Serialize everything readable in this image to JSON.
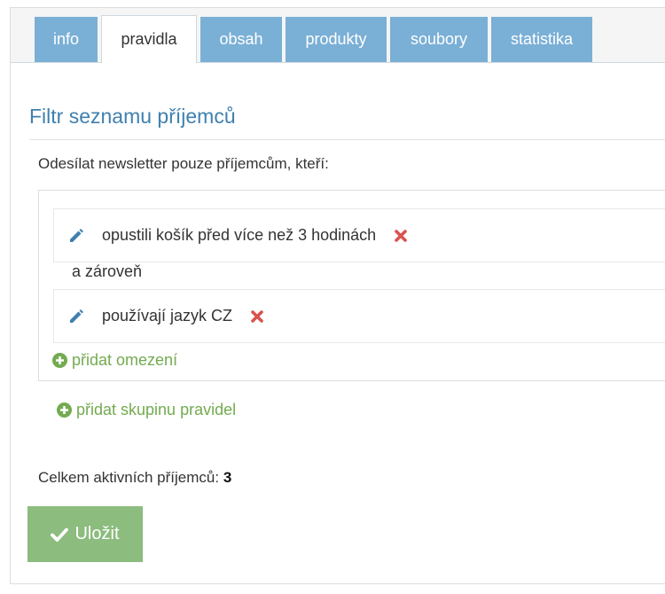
{
  "tabs": [
    {
      "label": "info",
      "active": false
    },
    {
      "label": "pravidla",
      "active": true
    },
    {
      "label": "obsah",
      "active": false
    },
    {
      "label": "produkty",
      "active": false
    },
    {
      "label": "soubory",
      "active": false
    },
    {
      "label": "statistika",
      "active": false
    }
  ],
  "filter": {
    "heading": "Filtr seznamu příjemců",
    "intro": "Odesílat newsletter pouze příjemcům, kteří:",
    "rules": [
      {
        "text": "opustili košík před více než 3 hodinách"
      },
      {
        "text": "používají jazyk CZ"
      }
    ],
    "and_label": "a zároveň",
    "add_condition": "přidat omezení",
    "add_group": "přidat skupinu pravidel"
  },
  "total": {
    "label": "Celkem aktivních příjemců:",
    "value": "3"
  },
  "save_label": "Uložit",
  "colors": {
    "tab_bg": "#7aafd6",
    "heading": "#3f80ae",
    "link_green": "#73ab50",
    "save_green": "#8cbc7e",
    "delete_red": "#d9534f",
    "edit_blue": "#3f80ae"
  },
  "icons": {
    "edit": "pencil-icon",
    "delete": "close-icon",
    "add": "plus-circle-icon",
    "save": "check-icon"
  }
}
